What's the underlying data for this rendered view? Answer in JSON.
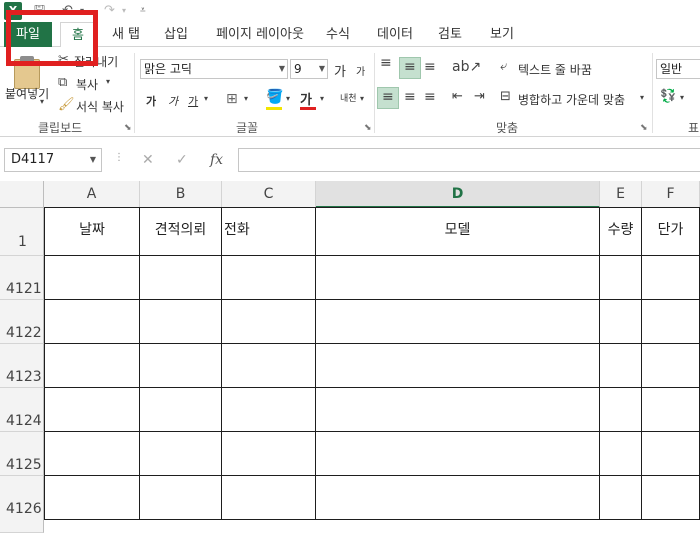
{
  "qat": {
    "app_icon": "X",
    "save_icon": "save-icon",
    "undo_icon": "undo-icon",
    "redo_icon": "redo-icon"
  },
  "tabs": [
    {
      "label": "파일"
    },
    {
      "label": "홈"
    },
    {
      "label": "새 탭"
    },
    {
      "label": "삽입"
    },
    {
      "label": "페이지 레이아웃"
    },
    {
      "label": "수식"
    },
    {
      "label": "데이터"
    },
    {
      "label": "검토"
    },
    {
      "label": "보기"
    }
  ],
  "ribbon": {
    "clipboard": {
      "paste": "붙여넣기",
      "cut": "잘라내기",
      "copy": "복사",
      "format_painter": "서식 복사",
      "group_label": "클립보드"
    },
    "font": {
      "font_name": "맑은 고딕",
      "font_size": "9",
      "grow": "가",
      "shrink": "가",
      "bold": "가",
      "italic": "가",
      "underline": "가",
      "font_color": "가",
      "phonetic": "내천",
      "group_label": "글꼴"
    },
    "alignment": {
      "wrap_text": "텍스트 줄 바꿈",
      "merge_center": "병합하고 가운데 맞춤",
      "group_label": "맞춤"
    },
    "number": {
      "format": "일반",
      "group_label": "표"
    }
  },
  "formula_bar": {
    "name_box": "D4117",
    "cancel": "✕",
    "enter": "✓",
    "fx": "fx",
    "value": ""
  },
  "grid": {
    "columns": [
      "A",
      "B",
      "C",
      "D",
      "E",
      "F"
    ],
    "selected_column": "D",
    "header_row": {
      "row_number": "1",
      "cells": [
        "날짜",
        "견적의뢰",
        "전화",
        "모델",
        "수량",
        "단가"
      ]
    },
    "rows": [
      "4121",
      "4122",
      "4123",
      "4124",
      "4125",
      "4126"
    ]
  }
}
